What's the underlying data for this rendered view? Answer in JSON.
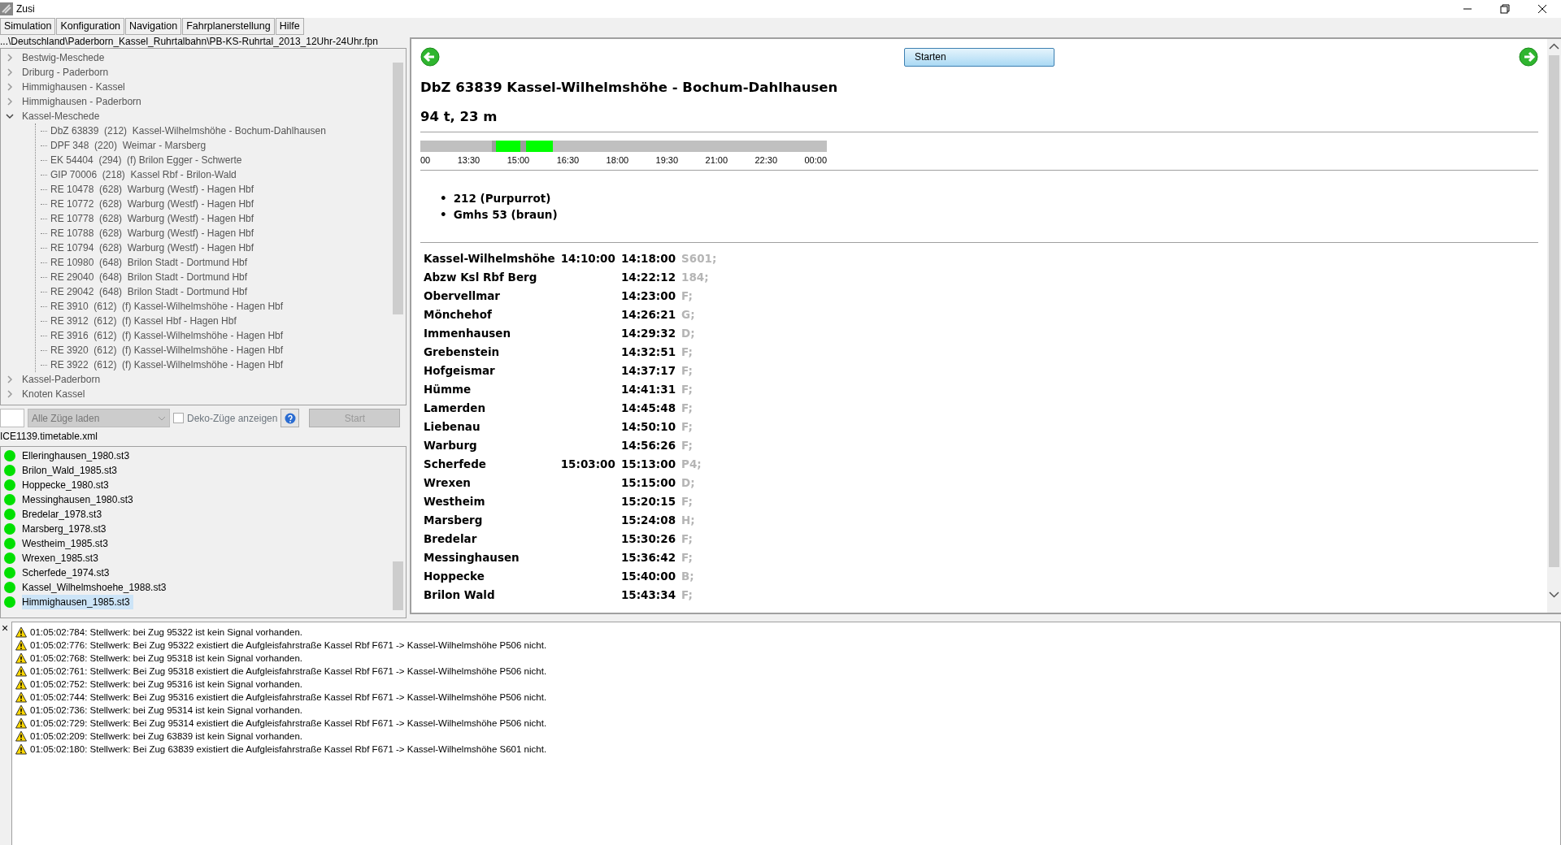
{
  "window": {
    "title": "Zusi"
  },
  "menu": [
    {
      "label": "Simulation"
    },
    {
      "label": "Konfiguration"
    },
    {
      "label": "Navigation"
    },
    {
      "label": "Fahrplanerstellung"
    },
    {
      "label": "Hilfe"
    }
  ],
  "path": "...\\Deutschland\\Paderborn_Kassel_Ruhrtalbahn\\PB-KS-Ruhrtal_2013_12Uhr-24Uhr.fpn",
  "tree": [
    {
      "label": "Bestwig-Meschede",
      "expanded": false
    },
    {
      "label": "Driburg - Paderborn",
      "expanded": false
    },
    {
      "label": "Himmighausen - Kassel",
      "expanded": false
    },
    {
      "label": "Himmighausen - Paderborn",
      "expanded": false
    },
    {
      "label": "Kassel-Meschede",
      "expanded": true,
      "children": [
        {
          "label": "DbZ 63839  (212)  Kassel-Wilhelmshöhe - Bochum-Dahlhausen"
        },
        {
          "label": "DPF 348  (220)  Weimar - Marsberg"
        },
        {
          "label": "EK 54404  (294)  (f) Brilon Egger - Schwerte"
        },
        {
          "label": "GIP 70006  (218)  Kassel Rbf - Brilon-Wald"
        },
        {
          "label": "RE 10478  (628)  Warburg (Westf) - Hagen Hbf"
        },
        {
          "label": "RE 10772  (628)  Warburg (Westf) - Hagen Hbf"
        },
        {
          "label": "RE 10778  (628)  Warburg (Westf) - Hagen Hbf"
        },
        {
          "label": "RE 10788  (628)  Warburg (Westf) - Hagen Hbf"
        },
        {
          "label": "RE 10794  (628)  Warburg (Westf) - Hagen Hbf"
        },
        {
          "label": "RE 10980  (648)  Brilon Stadt - Dortmund Hbf"
        },
        {
          "label": "RE 29040  (648)  Brilon Stadt - Dortmund Hbf"
        },
        {
          "label": "RE 29042  (648)  Brilon Stadt - Dortmund Hbf"
        },
        {
          "label": "RE 3910  (612)  (f) Kassel-Wilhelmshöhe - Hagen Hbf"
        },
        {
          "label": "RE 3912  (612)  (f) Kassel Hbf - Hagen Hbf"
        },
        {
          "label": "RE 3916  (612)  (f) Kassel-Wilhelmshöhe - Hagen Hbf"
        },
        {
          "label": "RE 3920  (612)  (f) Kassel-Wilhelmshöhe - Hagen Hbf"
        },
        {
          "label": "RE 3922  (612)  (f) Kassel-Wilhelmshöhe - Hagen Hbf"
        }
      ]
    },
    {
      "label": "Kassel-Paderborn",
      "expanded": false
    },
    {
      "label": "Knoten Kassel",
      "expanded": false
    }
  ],
  "controls": {
    "train_select": {
      "value": "Alle Züge laden",
      "disabled": true
    },
    "deko_checkbox": {
      "label": "Deko-Züge anzeigen",
      "checked": false
    },
    "start_button": {
      "label": "Start",
      "disabled": true
    }
  },
  "timetable_file": "ICE1139.timetable.xml",
  "stations": [
    {
      "label": "Elleringhausen_1980.st3",
      "color": "#00e000",
      "selected": false
    },
    {
      "label": "Brilon_Wald_1985.st3",
      "color": "#00e000",
      "selected": false
    },
    {
      "label": "Hoppecke_1980.st3",
      "color": "#00e000",
      "selected": false
    },
    {
      "label": "Messinghausen_1980.st3",
      "color": "#00e000",
      "selected": false
    },
    {
      "label": "Bredelar_1978.st3",
      "color": "#00e000",
      "selected": false
    },
    {
      "label": "Marsberg_1978.st3",
      "color": "#00e000",
      "selected": false
    },
    {
      "label": "Westheim_1985.st3",
      "color": "#00e000",
      "selected": false
    },
    {
      "label": "Wrexen_1985.st3",
      "color": "#00e000",
      "selected": false
    },
    {
      "label": "Scherfede_1974.st3",
      "color": "#00e000",
      "selected": false
    },
    {
      "label": "Kassel_Wilhelmshoehe_1988.st3",
      "color": "#00e000",
      "selected": false
    },
    {
      "label": "Himmighausen_1985.st3",
      "color": "#00e000",
      "selected": true
    }
  ],
  "detail": {
    "start_button": "Starten",
    "title": "DbZ 63839 Kassel-Wilhelmshöhe - Bochum-Dahlhausen",
    "subtitle": "94 t, 23 m",
    "timeline_ticks": [
      "00",
      "13:30",
      "15:00",
      "16:30",
      "18:00",
      "19:30",
      "21:00",
      "22:30",
      "00:00"
    ],
    "vehicles": [
      {
        "bullet": "•",
        "label": "212 (Purpurrot)"
      },
      {
        "bullet": "•",
        "label": "Gmhs 53 (braun)"
      }
    ],
    "stops": [
      {
        "station": "Kassel-Wilhelmshöhe",
        "arrival": "14:10:00",
        "departure": "14:18:00",
        "track": "S601;"
      },
      {
        "station": "Abzw Ksl Rbf Berg",
        "departure": "14:22:12",
        "track": "184;"
      },
      {
        "station": "Obervellmar",
        "departure": "14:23:00",
        "track": "F;"
      },
      {
        "station": "Mönchehof",
        "departure": "14:26:21",
        "track": "G;"
      },
      {
        "station": "Immenhausen",
        "departure": "14:29:32",
        "track": "D;"
      },
      {
        "station": "Grebenstein",
        "departure": "14:32:51",
        "track": "F;"
      },
      {
        "station": "Hofgeismar",
        "departure": "14:37:17",
        "track": "F;"
      },
      {
        "station": "Hümme",
        "departure": "14:41:31",
        "track": "F;"
      },
      {
        "station": "Lamerden",
        "departure": "14:45:48",
        "track": "F;"
      },
      {
        "station": "Liebenau",
        "departure": "14:50:10",
        "track": "F;"
      },
      {
        "station": "Warburg",
        "departure": "14:56:26",
        "track": "F;"
      },
      {
        "station": "Scherfede",
        "arrival": "15:03:00",
        "departure": "15:13:00",
        "track": "P4;"
      },
      {
        "station": "Wrexen",
        "departure": "15:15:00",
        "track": "D;"
      },
      {
        "station": "Westheim",
        "departure": "15:20:15",
        "track": "F;"
      },
      {
        "station": "Marsberg",
        "departure": "15:24:08",
        "track": "H;"
      },
      {
        "station": "Bredelar",
        "departure": "15:30:26",
        "track": "F;"
      },
      {
        "station": "Messinghausen",
        "departure": "15:36:42",
        "track": "F;"
      },
      {
        "station": "Hoppecke",
        "departure": "15:40:00",
        "track": "B;"
      },
      {
        "station": "Brilon Wald",
        "departure": "15:43:34",
        "track": "F;"
      }
    ]
  },
  "log": {
    "close": "×",
    "entries": [
      "01:05:02:784: Stellwerk: bei Zug 95322 ist kein Signal vorhanden.",
      "01:05:02:776: Stellwerk: Bei Zug 95322 existiert die Aufgleisfahrstraße Kassel Rbf F671 -> Kassel-Wilhelmshöhe P506 nicht.",
      "01:05:02:768: Stellwerk: bei Zug 95318 ist kein Signal vorhanden.",
      "01:05:02:761: Stellwerk: Bei Zug 95318 existiert die Aufgleisfahrstraße Kassel Rbf F671 -> Kassel-Wilhelmshöhe P506 nicht.",
      "01:05:02:752: Stellwerk: bei Zug 95316 ist kein Signal vorhanden.",
      "01:05:02:744: Stellwerk: Bei Zug 95316 existiert die Aufgleisfahrstraße Kassel Rbf F671 -> Kassel-Wilhelmshöhe P506 nicht.",
      "01:05:02:736: Stellwerk: bei Zug 95314 ist kein Signal vorhanden.",
      "01:05:02:729: Stellwerk: Bei Zug 95314 existiert die Aufgleisfahrstraße Kassel Rbf F671 -> Kassel-Wilhelmshöhe P506 nicht.",
      "01:05:02:209: Stellwerk: bei Zug 63839 ist kein Signal vorhanden.",
      "01:05:02:180: Stellwerk: Bei Zug 63839 existiert die Aufgleisfahrstraße Kassel Rbf F671 -> Kassel-Wilhelmshöhe S601 nicht."
    ]
  }
}
